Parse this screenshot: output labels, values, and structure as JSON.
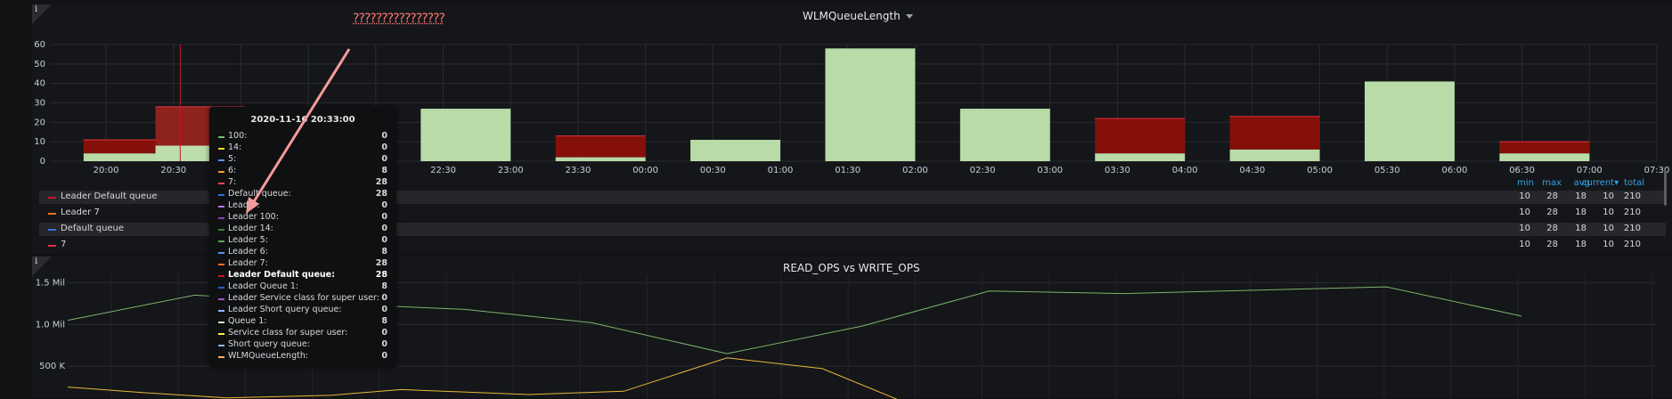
{
  "panel1": {
    "title": "WLMQueueLength",
    "warning": "????????????????",
    "info_icon": "i",
    "chart_data": {
      "type": "bar",
      "ylim": [
        0,
        60
      ],
      "y_ticks": [
        "0",
        "10",
        "20",
        "30",
        "40",
        "50",
        "60"
      ],
      "x_ticks": [
        "20:00",
        "20:30",
        "21:00",
        "21:30",
        "22:00",
        "22:30",
        "23:00",
        "23:30",
        "00:00",
        "00:30",
        "01:00",
        "01:30",
        "02:00",
        "02:30",
        "03:00",
        "03:30",
        "04:00",
        "04:30",
        "05:00",
        "05:30",
        "06:00",
        "06:30",
        "07:00",
        "07:30"
      ],
      "bars": [
        {
          "start": "19:50",
          "green": 4,
          "red": 11
        },
        {
          "start": "20:22",
          "green": 8,
          "red": 28
        },
        {
          "start": "22:20",
          "green": 27,
          "red": 27
        },
        {
          "start": "23:20",
          "green": 2,
          "red": 13
        },
        {
          "start": "00:20",
          "green": 11,
          "red": 11
        },
        {
          "start": "01:20",
          "green": 58,
          "red": 58
        },
        {
          "start": "02:20",
          "green": 27,
          "red": 27
        },
        {
          "start": "03:20",
          "green": 4,
          "red": 22
        },
        {
          "start": "04:20",
          "green": 6,
          "red": 23
        },
        {
          "start": "05:20",
          "green": 41,
          "red": 41
        },
        {
          "start": "06:20",
          "green": 4,
          "red": 10
        }
      ],
      "hover_time": "20:33",
      "colors": {
        "green": "#b8dba7",
        "red": "#8b1008",
        "hover": "#c4162a"
      }
    },
    "legend": {
      "headers": [
        "min",
        "max",
        "avg",
        "current",
        "total"
      ],
      "rows": [
        {
          "name": "Leader Default queue",
          "color": "#c4162a",
          "min": "10",
          "max": "28",
          "avg": "18",
          "current": "10",
          "total": "210"
        },
        {
          "name": "Leader 7",
          "color": "#f2711c",
          "min": "10",
          "max": "28",
          "avg": "18",
          "current": "10",
          "total": "210"
        },
        {
          "name": "Default queue",
          "color": "#3274d9",
          "min": "10",
          "max": "28",
          "avg": "18",
          "current": "10",
          "total": "210"
        },
        {
          "name": "7",
          "color": "#e02f44",
          "min": "10",
          "max": "28",
          "avg": "18",
          "current": "10",
          "total": "210"
        }
      ]
    }
  },
  "tooltip": {
    "time": "2020-11-16 20:33:00",
    "rows": [
      {
        "name": "100:",
        "value": "0",
        "color": "#73bf69"
      },
      {
        "name": "14:",
        "value": "0",
        "color": "#fade2a"
      },
      {
        "name": "5:",
        "value": "0",
        "color": "#5794f2"
      },
      {
        "name": "6:",
        "value": "8",
        "color": "#ff9830"
      },
      {
        "name": "7:",
        "value": "28",
        "color": "#f2495c"
      },
      {
        "name": "Default queue:",
        "value": "28",
        "color": "#3274d9"
      },
      {
        "name": "Leader:",
        "value": "0",
        "color": "#b877d9"
      },
      {
        "name": "Leader 100:",
        "value": "0",
        "color": "#8f3bb8"
      },
      {
        "name": "Leader 14:",
        "value": "0",
        "color": "#37872d"
      },
      {
        "name": "Leader 5:",
        "value": "0",
        "color": "#56a64b"
      },
      {
        "name": "Leader 6:",
        "value": "8",
        "color": "#5794f2"
      },
      {
        "name": "Leader 7:",
        "value": "28",
        "color": "#f2711c"
      },
      {
        "name": "Leader Default queue:",
        "value": "28",
        "color": "#c4162a",
        "highlight": true
      },
      {
        "name": "Leader Queue 1:",
        "value": "8",
        "color": "#1f60c4"
      },
      {
        "name": "Leader Service class for super user:",
        "value": "0",
        "color": "#a352cc"
      },
      {
        "name": "Leader Short query queue:",
        "value": "0",
        "color": "#8ab8ff"
      },
      {
        "name": "Queue 1:",
        "value": "8",
        "color": "#c8f2c2"
      },
      {
        "name": "Service class for super user:",
        "value": "0",
        "color": "#ffee52"
      },
      {
        "name": "Short query queue:",
        "value": "0",
        "color": "#8ab8ff"
      },
      {
        "name": "WLMQueueLength:",
        "value": "0",
        "color": "#ffb357"
      }
    ]
  },
  "panel2": {
    "title": "READ_OPS vs WRITE_OPS",
    "info_icon": "i",
    "chart_data": {
      "type": "line",
      "y_ticks": [
        "500 K",
        "1.0 Mil",
        "1.5 Mil"
      ],
      "ylim": [
        0,
        1600000
      ],
      "series": [
        {
          "color": "#7eb26d",
          "points": [
            [
              0,
              1050000
            ],
            [
              1.6,
              1350000
            ],
            [
              3.3,
              1250000
            ],
            [
              5.0,
              1180000
            ],
            [
              6.6,
              1020000
            ],
            [
              8.3,
              650000
            ],
            [
              10,
              980000
            ],
            [
              11.6,
              1400000
            ],
            [
              13.3,
              1370000
            ],
            [
              16.6,
              1450000
            ],
            [
              18.3,
              1100000
            ]
          ]
        },
        {
          "color": "#eab839",
          "points": [
            [
              0,
              250000
            ],
            [
              1,
              180000
            ],
            [
              2,
              120000
            ],
            [
              3.3,
              150000
            ],
            [
              4.2,
              220000
            ],
            [
              5.8,
              160000
            ],
            [
              7,
              200000
            ],
            [
              8.3,
              600000
            ],
            [
              9.5,
              470000
            ],
            [
              10.5,
              80000
            ]
          ]
        }
      ],
      "x_range": [
        0,
        18.3
      ]
    }
  }
}
